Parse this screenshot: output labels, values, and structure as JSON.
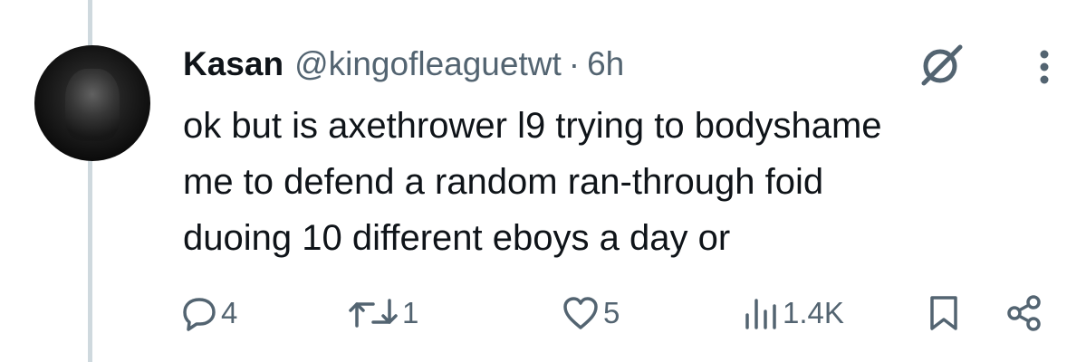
{
  "tweet": {
    "author_name": "Kasan",
    "handle": "@kingofleaguetwt",
    "separator": "·",
    "time": "6h",
    "text_lines": [
      "ok but is axethrower l9 trying to bodyshame",
      "me to defend a random ran-through foid",
      "duoing 10 different eboys a day or"
    ]
  },
  "actions": {
    "replies": "4",
    "reposts": "1",
    "likes": "5",
    "views": "1.4K"
  },
  "icons": {
    "avatar": "avatar",
    "grok": "grok-icon",
    "more": "more-icon",
    "reply": "reply-icon",
    "repost": "repost-icon",
    "like": "heart-icon",
    "views": "views-icon",
    "bookmark": "bookmark-icon",
    "share": "share-icon"
  },
  "colors": {
    "text": "#0f1419",
    "secondary": "#536471",
    "thread_line": "#cfd9de"
  }
}
